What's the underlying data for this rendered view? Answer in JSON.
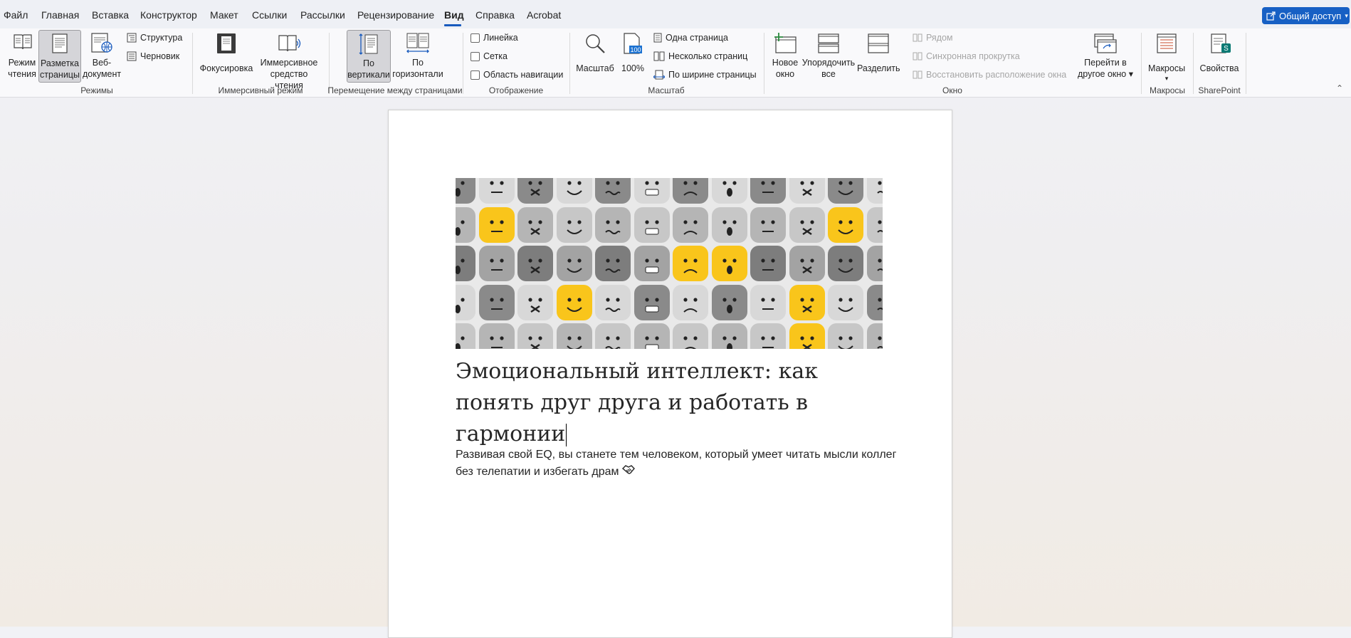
{
  "menu": {
    "tabs": [
      "Файл",
      "Главная",
      "Вставка",
      "Конструктор",
      "Макет",
      "Ссылки",
      "Рассылки",
      "Рецензирование",
      "Вид",
      "Справка",
      "Acrobat"
    ],
    "active": "Вид",
    "share_label": "Общий доступ"
  },
  "ribbon": {
    "modes": {
      "read_label1": "Режим",
      "read_label2": "чтения",
      "layout_label1": "Разметка",
      "layout_label2": "страницы",
      "web_label1": "Веб-",
      "web_label2": "документ",
      "outline": "Структура",
      "draft": "Черновик",
      "group": "Режимы"
    },
    "immersive": {
      "focus": "Фокусировка",
      "reader_label1": "Иммерсивное",
      "reader_label2": "средство чтения",
      "group": "Иммерсивный режим"
    },
    "page_movement": {
      "vertical_label1": "По",
      "vertical_label2": "вертикали",
      "horizontal_label1": "По",
      "horizontal_label2": "горизонтали",
      "group": "Перемещение между страницами"
    },
    "show": {
      "ruler": "Линейка",
      "grid": "Сетка",
      "nav_pane": "Область навигации",
      "group": "Отображение"
    },
    "zoom": {
      "zoom": "Масштаб",
      "hundred": "100%",
      "hundred_icon": "100",
      "one_page": "Одна страница",
      "multi_page": "Несколько страниц",
      "page_width": "По ширине страницы",
      "group": "Масштаб"
    },
    "window": {
      "new_label1": "Новое",
      "new_label2": "окно",
      "arrange_label1": "Упорядочить",
      "arrange_label2": "все",
      "split": "Разделить",
      "side_by_side": "Рядом",
      "sync_scroll": "Синхронная прокрутка",
      "reset_pos": "Восстановить расположение окна",
      "switch_label1": "Перейти в",
      "switch_label2": "другое окно",
      "group": "Окно"
    },
    "macros": {
      "label": "Макросы",
      "group": "Макросы"
    },
    "sharepoint": {
      "label": "Свойства",
      "group": "SharePoint"
    }
  },
  "document": {
    "title": "Эмоциональный интеллект: как понять друг друга и работать в гармонии",
    "body": "Развивая свой EQ, вы станете тем человеком, который умеет читать мысли коллег без телепатии и избегать драм"
  },
  "colors": {
    "accent": "#185abd",
    "share_bg": "#1760c4",
    "emoji_yellow": "#f9c51b"
  },
  "icons": {
    "share": "share-icon",
    "read": "read-mode-icon",
    "layout": "print-layout-icon",
    "web": "web-layout-icon",
    "outline": "outline-icon",
    "draft": "draft-icon",
    "focus": "focus-icon",
    "reader": "immersive-reader-icon",
    "vertical": "vertical-scroll-icon",
    "horizontal": "side-to-side-icon",
    "zoom": "magnifier-icon",
    "new_window": "new-window-icon",
    "arrange": "arrange-all-icon",
    "split": "split-icon",
    "switch": "switch-windows-icon",
    "macros": "macros-icon",
    "properties": "sharepoint-properties-icon",
    "collapse": "collapse-ribbon-icon",
    "handshake": "handshake-emoji-icon"
  }
}
